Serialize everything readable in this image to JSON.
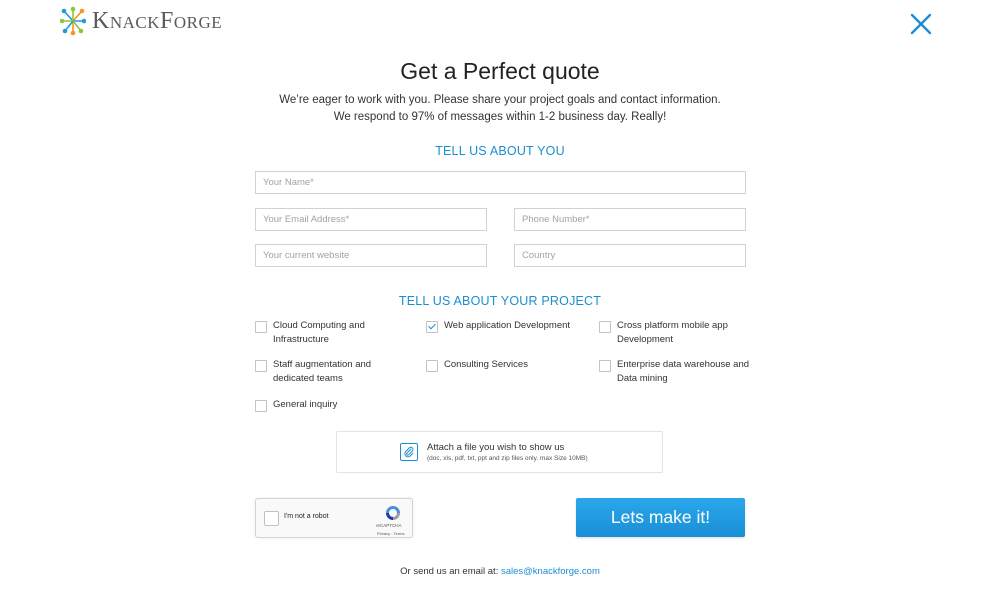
{
  "brand": {
    "name": "KnackForge",
    "colors": {
      "accent": "#1c8ed0",
      "button": "#1a8fd6"
    }
  },
  "icons": {
    "logo": "starburst-logo-icon",
    "close": "close-icon",
    "attach": "paperclip-icon",
    "recaptcha": "recaptcha-logo-icon",
    "check": "checkmark-icon"
  },
  "header": {
    "title": "Get a Perfect quote",
    "subtitle_line1": "We’re eager to work with you. Please share your project goals and contact information.",
    "subtitle_line2": "We respond to 97% of messages within 1-2 business day. Really!"
  },
  "about_you": {
    "heading": "TELL US ABOUT YOU",
    "name_placeholder": "Your Name*",
    "email_placeholder": "Your Email Address*",
    "phone_placeholder": "Phone Number*",
    "website_placeholder": "Your current website",
    "country_placeholder": "Country"
  },
  "project": {
    "heading": "TELL US ABOUT YOUR PROJECT",
    "options": [
      {
        "label": "Cloud Computing and Infrastructure",
        "checked": false
      },
      {
        "label": "Web application Development",
        "checked": true
      },
      {
        "label": "Cross platform mobile app Development",
        "checked": false
      },
      {
        "label": "Staff augmentation and dedicated teams",
        "checked": false
      },
      {
        "label": "Consulting Services",
        "checked": false
      },
      {
        "label": "Enterprise data warehouse and Data mining",
        "checked": false
      },
      {
        "label": "General inquiry",
        "checked": false
      }
    ]
  },
  "attach": {
    "title": "Attach a file you wish to show us",
    "note": "(doc, xls, pdf, txt, ppt and zip files only. max Size 10MB)"
  },
  "recaptcha": {
    "label": "I'm not a robot",
    "brand": "reCAPTCHA",
    "links": "Privacy - Terms"
  },
  "submit_label": "Lets make it!",
  "footer": {
    "text": "Or send us an email at: ",
    "email": "sales@knackforge.com"
  }
}
